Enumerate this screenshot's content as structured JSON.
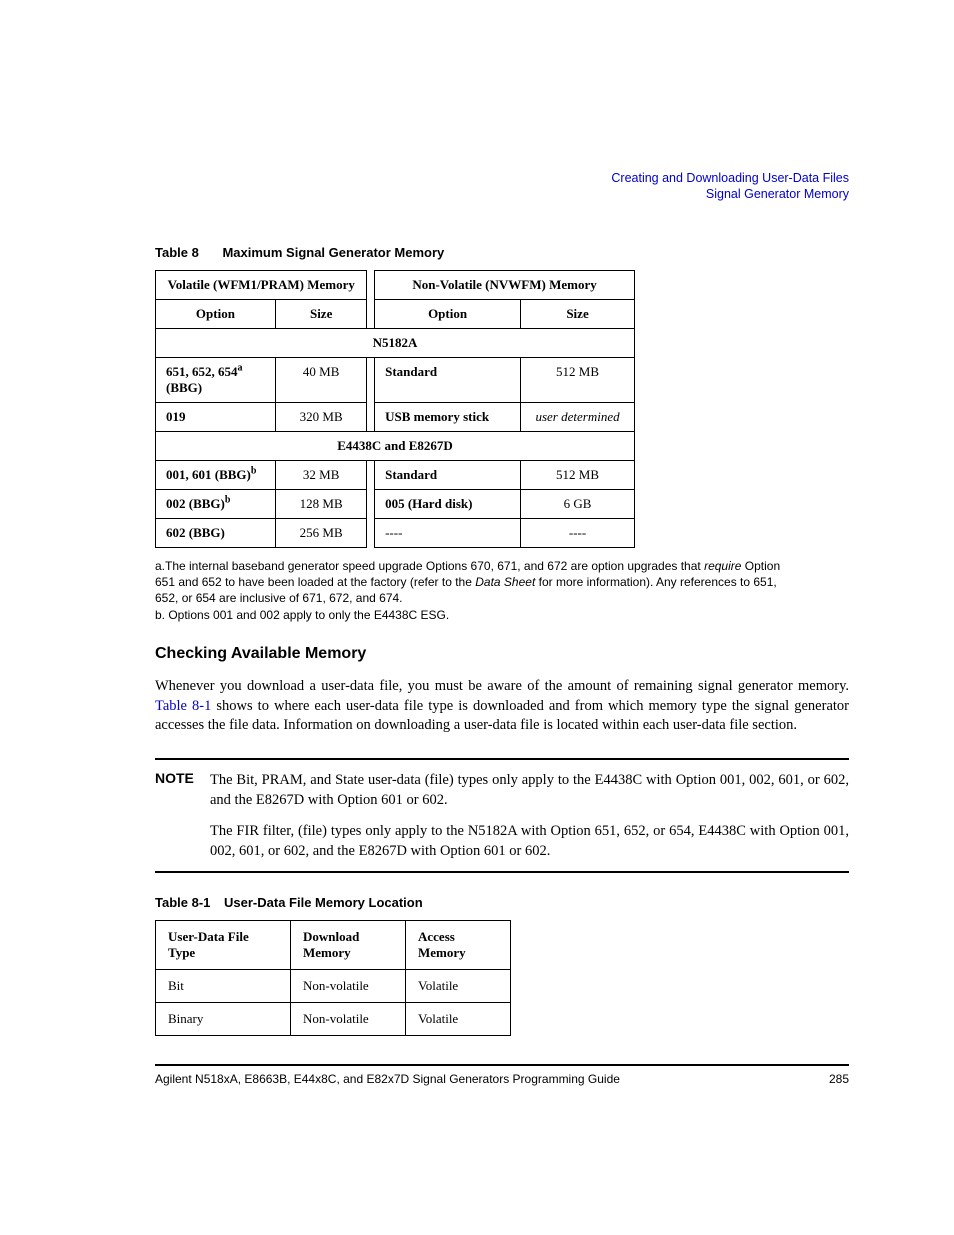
{
  "header": {
    "line1": "Creating and Downloading User-Data Files",
    "line2": "Signal Generator Memory"
  },
  "table8": {
    "caption_num": "Table 8",
    "caption_title": "Maximum Signal Generator Memory",
    "vol_header": "Volatile (WFM1/PRAM) Memory",
    "nv_header": "Non-Volatile (NVWFM) Memory",
    "col_option": "Option",
    "col_size": "Size",
    "section1": "N5182A",
    "row1": {
      "opt_pre": "651, 652, 654",
      "opt_sup": "a",
      "opt_post": " (BBG)",
      "size": "40 MB",
      "nvopt": "Standard",
      "nvsize": "512 MB"
    },
    "row2": {
      "opt": "019",
      "size": "320 MB",
      "nvopt": "USB memory stick",
      "nvsize": "user determined"
    },
    "section2": "E4438C and E8267D",
    "row3": {
      "opt_pre": "001, 601 (BBG)",
      "opt_sup": "b",
      "size": "32 MB",
      "nvopt": "Standard",
      "nvsize": "512 MB"
    },
    "row4": {
      "opt_pre": "002 (BBG)",
      "opt_sup": "b",
      "size": "128 MB",
      "nvopt": "005 (Hard disk)",
      "nvsize": "6 GB"
    },
    "row5": {
      "opt": "602 (BBG)",
      "size": "256 MB",
      "nvopt": "----",
      "nvsize": "----"
    }
  },
  "footnotes": {
    "a_pre": "a.The internal baseband generator speed upgrade Options 670, 671, and 672 are option upgrades that ",
    "a_italic1": "require",
    "a_mid": " Option 651 and 652 to have been loaded at the factory (refer to the ",
    "a_italic2": "Data Sheet",
    "a_post": " for more information). Any references to 651, 652, or 654 are inclusive of 671, 672, and 674.",
    "b": "b. Options 001 and 002 apply to only the E4438C ESG."
  },
  "checking": {
    "heading": "Checking Available Memory",
    "para_pre": "Whenever you download a user-data file, you must be aware of the amount of remaining signal generator memory. ",
    "para_link": "Table 8-1",
    "para_post": " shows to where each user-data file type is downloaded and from which memory type the signal generator accesses the file data. Information on downloading a user-data file is located within each user-data file section."
  },
  "note": {
    "label": "NOTE",
    "p1": "The Bit, PRAM, and State user-data (file) types only apply to the E4438C with Option 001, 002, 601, or 602, and the E8267D with Option 601 or 602.",
    "p2": "The FIR filter, (file) types only apply to the N5182A with Option 651, 652, or 654, E4438C with Option 001, 002, 601, or 602, and the E8267D with Option 601 or 602."
  },
  "table81": {
    "caption_num": "Table 8-1",
    "caption_title": "User-Data File Memory Location",
    "h1": "User-Data File Type",
    "h2": "Download Memory",
    "h3": "Access Memory",
    "rows": [
      {
        "c1": "Bit",
        "c2": "Non-volatile",
        "c3": "Volatile"
      },
      {
        "c1": "Binary",
        "c2": "Non-volatile",
        "c3": "Volatile"
      }
    ]
  },
  "footer": {
    "left": "Agilent N518xA, E8663B, E44x8C, and E82x7D Signal Generators Programming Guide",
    "right": "285"
  },
  "chart_data": [
    {
      "type": "table",
      "title": "Maximum Signal Generator Memory",
      "sections": [
        {
          "model": "N5182A",
          "rows": [
            {
              "volatile_option": "651, 652, 654 (BBG)",
              "volatile_size": "40 MB",
              "nonvolatile_option": "Standard",
              "nonvolatile_size": "512 MB"
            },
            {
              "volatile_option": "019",
              "volatile_size": "320 MB",
              "nonvolatile_option": "USB memory stick",
              "nonvolatile_size": "user determined"
            }
          ]
        },
        {
          "model": "E4438C and E8267D",
          "rows": [
            {
              "volatile_option": "001, 601 (BBG)",
              "volatile_size": "32 MB",
              "nonvolatile_option": "Standard",
              "nonvolatile_size": "512 MB"
            },
            {
              "volatile_option": "002 (BBG)",
              "volatile_size": "128 MB",
              "nonvolatile_option": "005 (Hard disk)",
              "nonvolatile_size": "6 GB"
            },
            {
              "volatile_option": "602 (BBG)",
              "volatile_size": "256 MB",
              "nonvolatile_option": "----",
              "nonvolatile_size": "----"
            }
          ]
        }
      ]
    },
    {
      "type": "table",
      "title": "User-Data File Memory Location",
      "columns": [
        "User-Data File Type",
        "Download Memory",
        "Access Memory"
      ],
      "rows": [
        [
          "Bit",
          "Non-volatile",
          "Volatile"
        ],
        [
          "Binary",
          "Non-volatile",
          "Volatile"
        ]
      ]
    }
  ]
}
